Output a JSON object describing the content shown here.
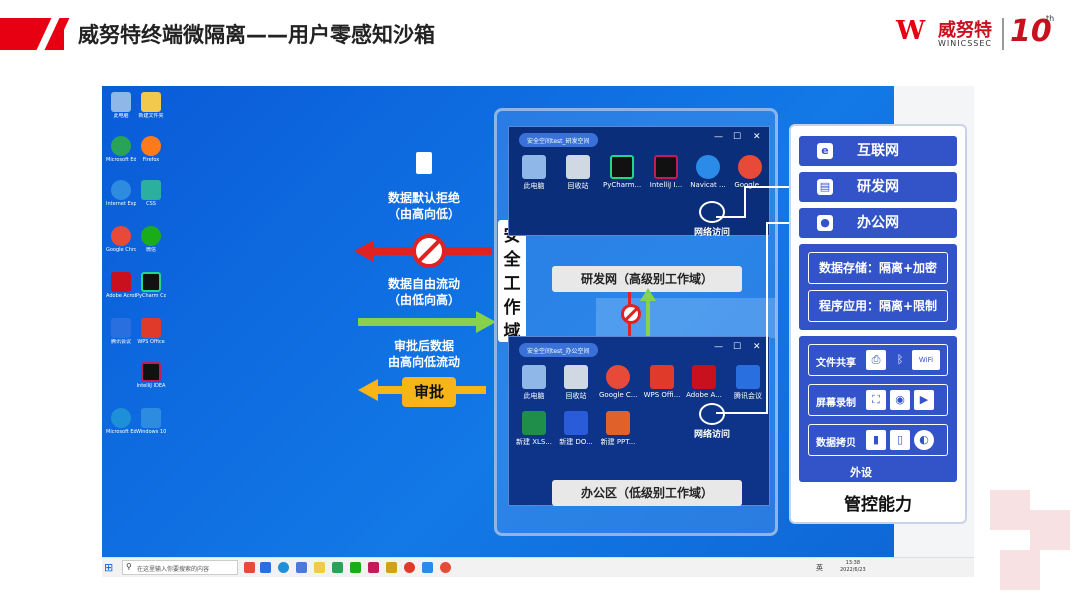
{
  "header": {
    "title": "威努特终端微隔离——用户零感知沙箱",
    "logo_cn": "威努特",
    "logo_en": "WINICSSEC",
    "logo_mark": "W",
    "logo_ten": "10",
    "logo_th": "th"
  },
  "desktop_icons": [
    {
      "label": "此电脑",
      "color": "#8fb8e8",
      "icon": "computer-icon"
    },
    {
      "label": "新建文件夹",
      "color": "#f2c94c",
      "icon": "folder-icon"
    },
    {
      "label": "Microsoft Edge",
      "color": "#2aa35a",
      "icon": "edge-icon"
    },
    {
      "label": "Firefox",
      "color": "#ff7a1a",
      "icon": "firefox-icon"
    },
    {
      "label": "Internet Explorer",
      "color": "#2d8be0",
      "icon": "ie-icon"
    },
    {
      "label": "CSS",
      "color": "#2bb0a0",
      "icon": "app-icon"
    },
    {
      "label": "Google Chrome",
      "color": "#e84a3a",
      "icon": "chrome-icon"
    },
    {
      "label": "微信",
      "color": "#1aad19",
      "icon": "wechat-icon"
    },
    {
      "label": "Adobe Acrobat DC",
      "color": "#c8101e",
      "icon": "acrobat-icon"
    },
    {
      "label": "PyCharm Community",
      "color": "#21d789",
      "icon": "pycharm-icon"
    },
    {
      "label": "腾讯会议",
      "color": "#2a6fe0",
      "icon": "meeting-icon"
    },
    {
      "label": "WPS Office",
      "color": "#e03a2a",
      "icon": "wps-icon"
    },
    {
      "label": "IntelliJ IDEA",
      "color": "#c21b5a",
      "icon": "idea-icon"
    },
    {
      "label": "Microsoft Edge",
      "color": "#1e90d8",
      "icon": "edge-icon"
    },
    {
      "label": "Windows 10",
      "color": "#2d8be0",
      "icon": "windows-icon"
    }
  ],
  "flows": {
    "deny_label_1": "数据默认拒绝",
    "deny_label_2": "（由高向低）",
    "free_label_1": "数据自由流动",
    "free_label_2": "（由低向高）",
    "approve_label_1": "审批后数据",
    "approve_label_2": "由高向低流动",
    "approve_badge": "审批"
  },
  "security_domain": "安全工作域",
  "rd_window": {
    "tab": "安全空间test_研发空间",
    "minimize": "—",
    "maximize": "☐",
    "close": "✕",
    "apps": [
      {
        "label": "此电脑",
        "color": "#8fb8e8",
        "icon": "computer-icon"
      },
      {
        "label": "回收站",
        "color": "#cfd8e3",
        "icon": "recycle-bin-icon"
      },
      {
        "label": "PyCharm...",
        "color": "#21d789",
        "icon": "pycharm-icon"
      },
      {
        "label": "IntelliJ I...",
        "color": "#c21b5a",
        "icon": "idea-icon"
      },
      {
        "label": "Navicat ...",
        "color": "#2a8be8",
        "icon": "navicat-icon"
      },
      {
        "label": "Google...",
        "color": "#e84a3a",
        "icon": "chrome-icon"
      }
    ],
    "net_label": "网络访问",
    "zone_label": "研发网（高级别工作域）"
  },
  "office_window": {
    "tab": "安全空间test_办公空间",
    "minimize": "—",
    "maximize": "☐",
    "close": "✕",
    "apps": [
      {
        "label": "此电脑",
        "color": "#8fb8e8",
        "icon": "computer-icon"
      },
      {
        "label": "回收站",
        "color": "#cfd8e3",
        "icon": "recycle-bin-icon"
      },
      {
        "label": "Google C...",
        "color": "#e84a3a",
        "icon": "chrome-icon"
      },
      {
        "label": "WPS Offi...",
        "color": "#e03a2a",
        "icon": "wps-icon"
      },
      {
        "label": "Adobe A...",
        "color": "#c8101e",
        "icon": "acrobat-icon"
      },
      {
        "label": "腾讯会议",
        "color": "#2a6fe0",
        "icon": "meeting-icon"
      }
    ],
    "files": [
      {
        "label": "新建 XLS...",
        "color": "#1e8e4a",
        "icon": "xls-file-icon"
      },
      {
        "label": "新建 DO...",
        "color": "#2a5bd8",
        "icon": "doc-file-icon"
      },
      {
        "label": "新建 PPT...",
        "color": "#e0622a",
        "icon": "ppt-file-icon"
      }
    ],
    "net_label": "网络访问",
    "zone_label": "办公区（低级别工作域）"
  },
  "panel": {
    "internet": "互联网",
    "rd_net": "研发网",
    "office_net": "办公网",
    "storage": "数据存储：隔离+加密",
    "app": "程序应用：隔离+限制",
    "file_share": "文件共享",
    "screen_rec": "屏幕录制",
    "data_copy": "数据拷贝",
    "peripheral": "外设",
    "caption": "管控能力",
    "wifi_text": "WiFi"
  },
  "taskbar": {
    "search_placeholder": "在这里输入你要搜索的内容",
    "lang": "英",
    "time": "13:38",
    "date": "2022/6/23"
  }
}
